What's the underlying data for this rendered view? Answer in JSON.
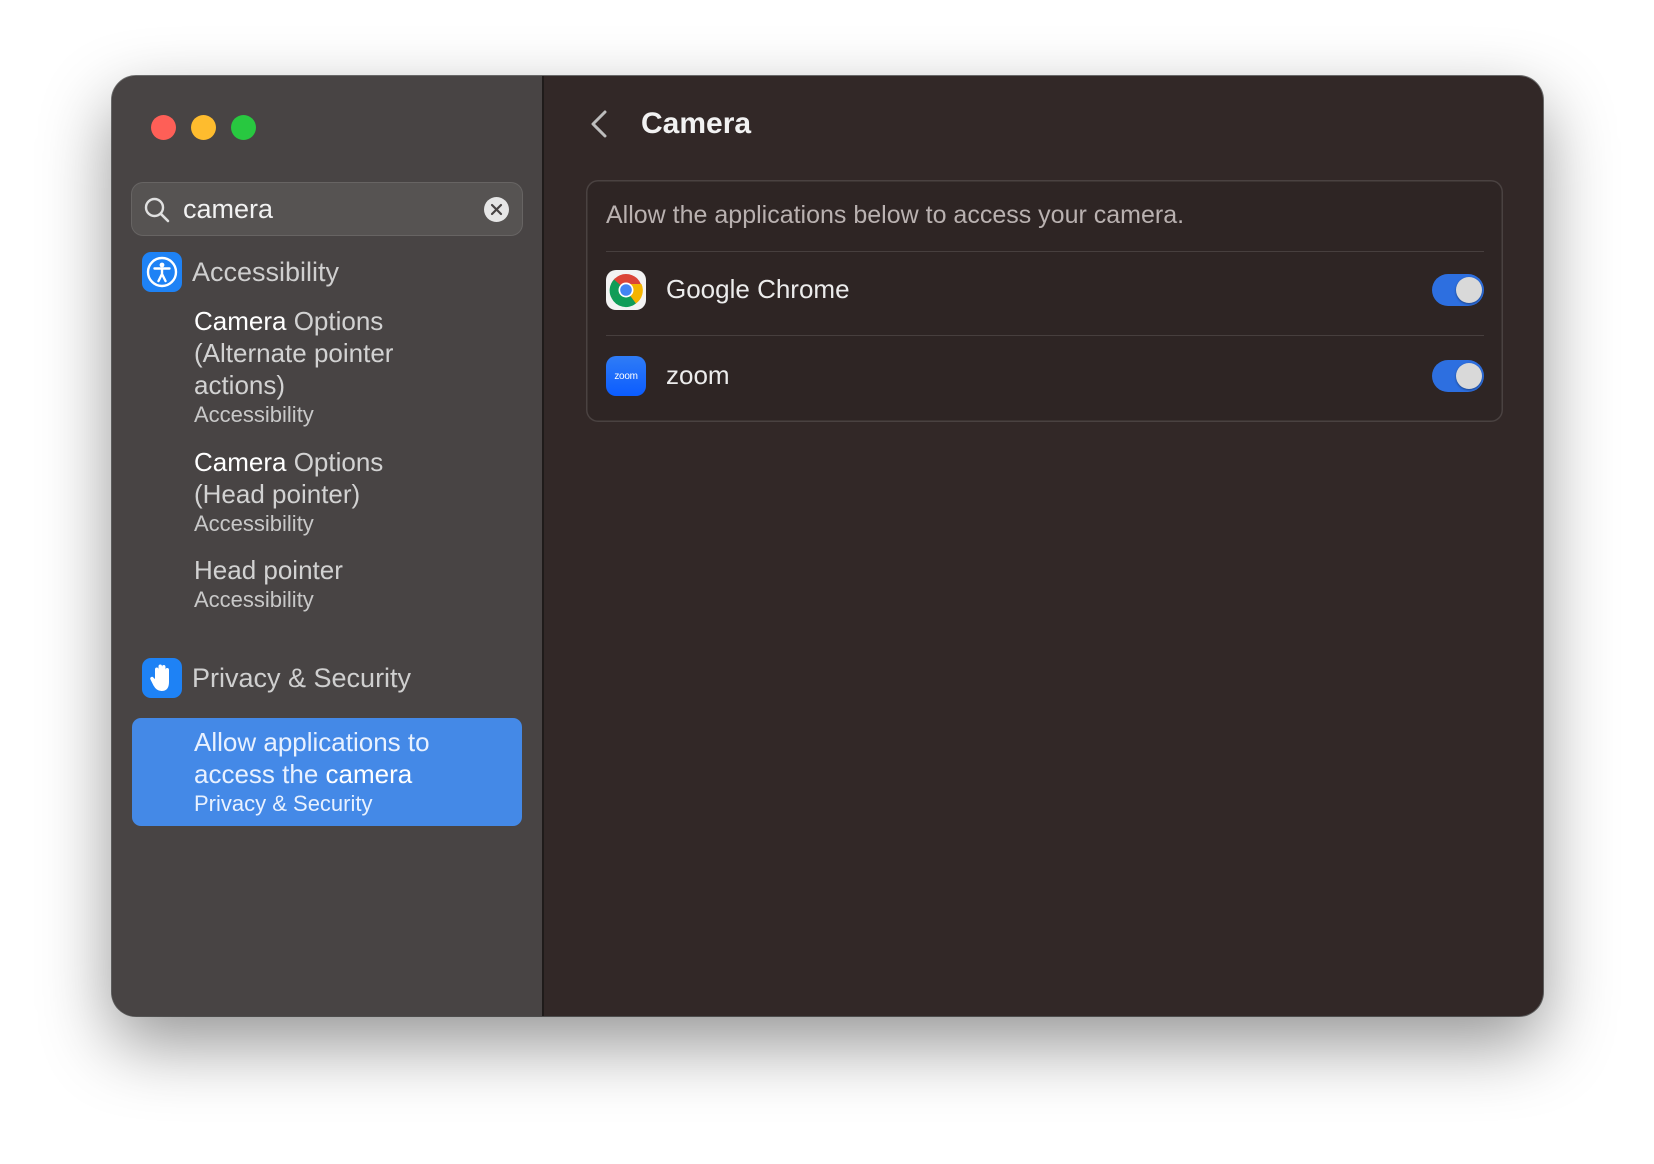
{
  "window": {
    "traffic_lights": [
      "close",
      "minimize",
      "zoom"
    ]
  },
  "search": {
    "value": "camera",
    "placeholder": "Search"
  },
  "sidebar": {
    "sections": [
      {
        "label": "Accessibility",
        "icon": "accessibility-icon",
        "results": [
          {
            "match": "Camera",
            "title_rest_line1": " Options",
            "title_line2": "(Alternate pointer",
            "title_line3": "actions)",
            "subtitle": "Accessibility"
          },
          {
            "match": "Camera",
            "title_rest_line1": " Options",
            "title_line2": "(Head pointer)",
            "subtitle": "Accessibility"
          },
          {
            "title_line1": "Head pointer",
            "subtitle": "Accessibility"
          }
        ]
      },
      {
        "label": "Privacy & Security",
        "icon": "hand-icon",
        "results": [
          {
            "title_line1": "Allow applications to",
            "title_line2_prefix": "access the ",
            "match": "camera",
            "subtitle": "Privacy & Security",
            "selected": true
          }
        ]
      }
    ]
  },
  "main": {
    "title": "Camera",
    "description": "Allow the applications below to access your camera.",
    "apps": [
      {
        "name": "Google Chrome",
        "icon": "chrome-icon",
        "enabled": true
      },
      {
        "name": "zoom",
        "icon": "zoom-icon",
        "icon_text": "zoom",
        "enabled": true
      }
    ]
  },
  "colors": {
    "accent": "#2d6fe0",
    "selection": "#4489e7",
    "sidebar_bg": "#484444",
    "content_bg": "#322827"
  }
}
